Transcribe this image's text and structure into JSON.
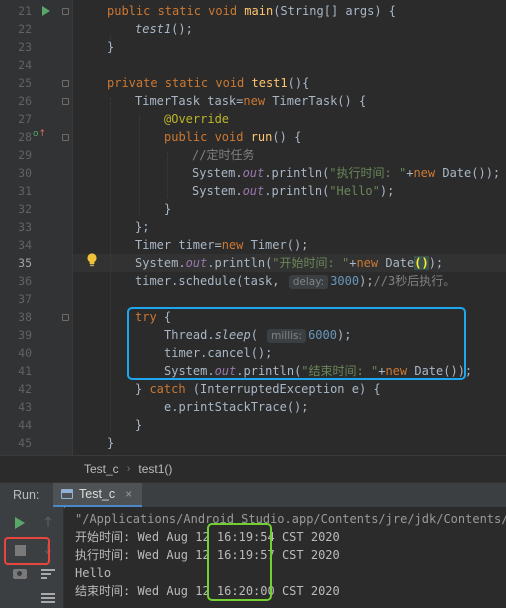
{
  "gutter": {
    "line_numbers": [
      "21",
      "22",
      "23",
      "24",
      "25",
      "26",
      "27",
      "28",
      "29",
      "30",
      "31",
      "32",
      "33",
      "34",
      "35",
      "36",
      "37",
      "38",
      "39",
      "40",
      "41",
      "42",
      "43",
      "44",
      "45"
    ],
    "current_line": "35"
  },
  "code": {
    "l21": {
      "kw": "public static void ",
      "fn": "main",
      "rest": "(String[] args) {"
    },
    "l22": {
      "call": "test1",
      "rest": "();"
    },
    "l23": {
      "text": "}"
    },
    "l25": {
      "kw": "private static void ",
      "fn": "test1",
      "rest": "(){"
    },
    "l26": {
      "a": "TimerTask task=",
      "kw": "new ",
      "b": "TimerTask() {"
    },
    "l27": {
      "ann": "@Override"
    },
    "l28": {
      "kw": "public void ",
      "fn": "run",
      "rest": "() {"
    },
    "l29": {
      "cmt": "//定时任务"
    },
    "l30": {
      "a": "System.",
      "fld": "out",
      "b": ".println(",
      "str": "\"执行时间: \"",
      "c": "+",
      "kw": "new ",
      "d": "Date());"
    },
    "l31": {
      "a": "System.",
      "fld": "out",
      "b": ".println(",
      "str": "\"Hello\"",
      "c": ");"
    },
    "l32": {
      "text": "}"
    },
    "l33": {
      "text": "};"
    },
    "l34": {
      "a": "Timer timer=",
      "kw": "new ",
      "b": "Timer();"
    },
    "l35": {
      "a": "System.",
      "fld": "out",
      "b": ".println(",
      "str": "\"开始时间: \"",
      "c": "+",
      "kw": "new ",
      "d": "Date",
      "e": "()",
      "f": ");"
    },
    "l36": {
      "a": "timer.schedule(task, ",
      "hint": "delay:",
      "num": "3000",
      "b": ");",
      "cmt": "//3秒后执行。"
    },
    "l38": {
      "kw": "try",
      "rest": " {"
    },
    "l39": {
      "a": "Thread.",
      "it": "sleep",
      "b": "( ",
      "hint": "millis:",
      "num": "6000",
      "c": ");"
    },
    "l40": {
      "text": "timer.cancel();"
    },
    "l41": {
      "a": "System.",
      "fld": "out",
      "b": ".println(",
      "str": "\"结束时间: \"",
      "c": "+",
      "kw": "new ",
      "d": "Date());"
    },
    "l42": {
      "a": "} ",
      "kw": "catch",
      "b": " (InterruptedException e) {"
    },
    "l43": {
      "text": "e.printStackTrace();"
    },
    "l44": {
      "text": "}"
    },
    "l45": {
      "text": "}"
    }
  },
  "breadcrumb": {
    "class_name": "Test_c",
    "method_name": "test1()",
    "separator": "›"
  },
  "run_panel": {
    "label": "Run:",
    "tab_label": "Test_c",
    "console_lines": [
      "\"/Applications/Android Studio.app/Contents/jre/jdk/Contents/Ho",
      "开始时间: Wed Aug 12 16:19:54 CST 2020",
      "执行时间: Wed Aug 12 16:19:57 CST 2020",
      "Hello",
      "结束时间: Wed Aug 12 16:20:00 CST 2020"
    ]
  },
  "icons": [
    "run-gutter-icon",
    "override-icon",
    "lightbulb-icon",
    "rerun-icon",
    "stop-icon",
    "up-arrow-icon",
    "down-arrow-icon",
    "camera-icon",
    "soft-wrap-icon",
    "scroll-to-end-icon",
    "console-tab-icon",
    "close-icon"
  ],
  "colors": {
    "highlight_blue": "#1ea7ef",
    "highlight_green": "#72d031",
    "highlight_red": "#e8453c",
    "run_green": "#59a869"
  }
}
